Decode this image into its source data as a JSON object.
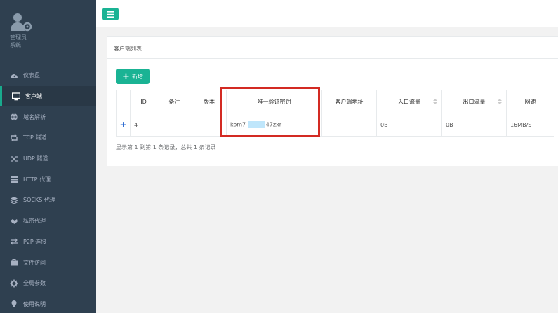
{
  "sidebar": {
    "role_line1": "管理员",
    "role_line2": "系统",
    "items": [
      {
        "label": "仪表盘",
        "icon": "dashboard-icon"
      },
      {
        "label": "客户端",
        "icon": "monitor-icon",
        "active": true
      },
      {
        "label": "域名解析",
        "icon": "globe-icon"
      },
      {
        "label": "TCP 隧道",
        "icon": "retweet-icon"
      },
      {
        "label": "UDP 隧道",
        "icon": "shuffle-icon"
      },
      {
        "label": "HTTP 代理",
        "icon": "server-icon"
      },
      {
        "label": "SOCKS 代理",
        "icon": "stack-icon"
      },
      {
        "label": "私密代理",
        "icon": "handshake-icon"
      },
      {
        "label": "P2P 连接",
        "icon": "exchange-icon"
      },
      {
        "label": "文件访问",
        "icon": "briefcase-icon"
      },
      {
        "label": "全局参数",
        "icon": "gear-icon"
      },
      {
        "label": "使用说明",
        "icon": "lightbulb-icon"
      }
    ]
  },
  "panel": {
    "title": "客户端列表",
    "add_label": "新增",
    "footer": "显示第 1 到第 1 条记录，总共 1 条记录"
  },
  "table": {
    "columns": [
      "",
      "ID",
      "备注",
      "版本",
      "唯一验证密钥",
      "客户端地址",
      "入口流量",
      "出口流量",
      "网速"
    ],
    "rows": [
      {
        "expand": "+",
        "id": "4",
        "remark": "",
        "version": "",
        "key_prefix": "kom7",
        "key_suffix": "47zxr",
        "address": "",
        "in_flow": "0B",
        "out_flow": "0B",
        "speed": "16MB/S"
      }
    ]
  },
  "colors": {
    "sidebar_bg": "#2f4050",
    "accent": "#1ab394",
    "highlight_box": "#d32a23"
  }
}
